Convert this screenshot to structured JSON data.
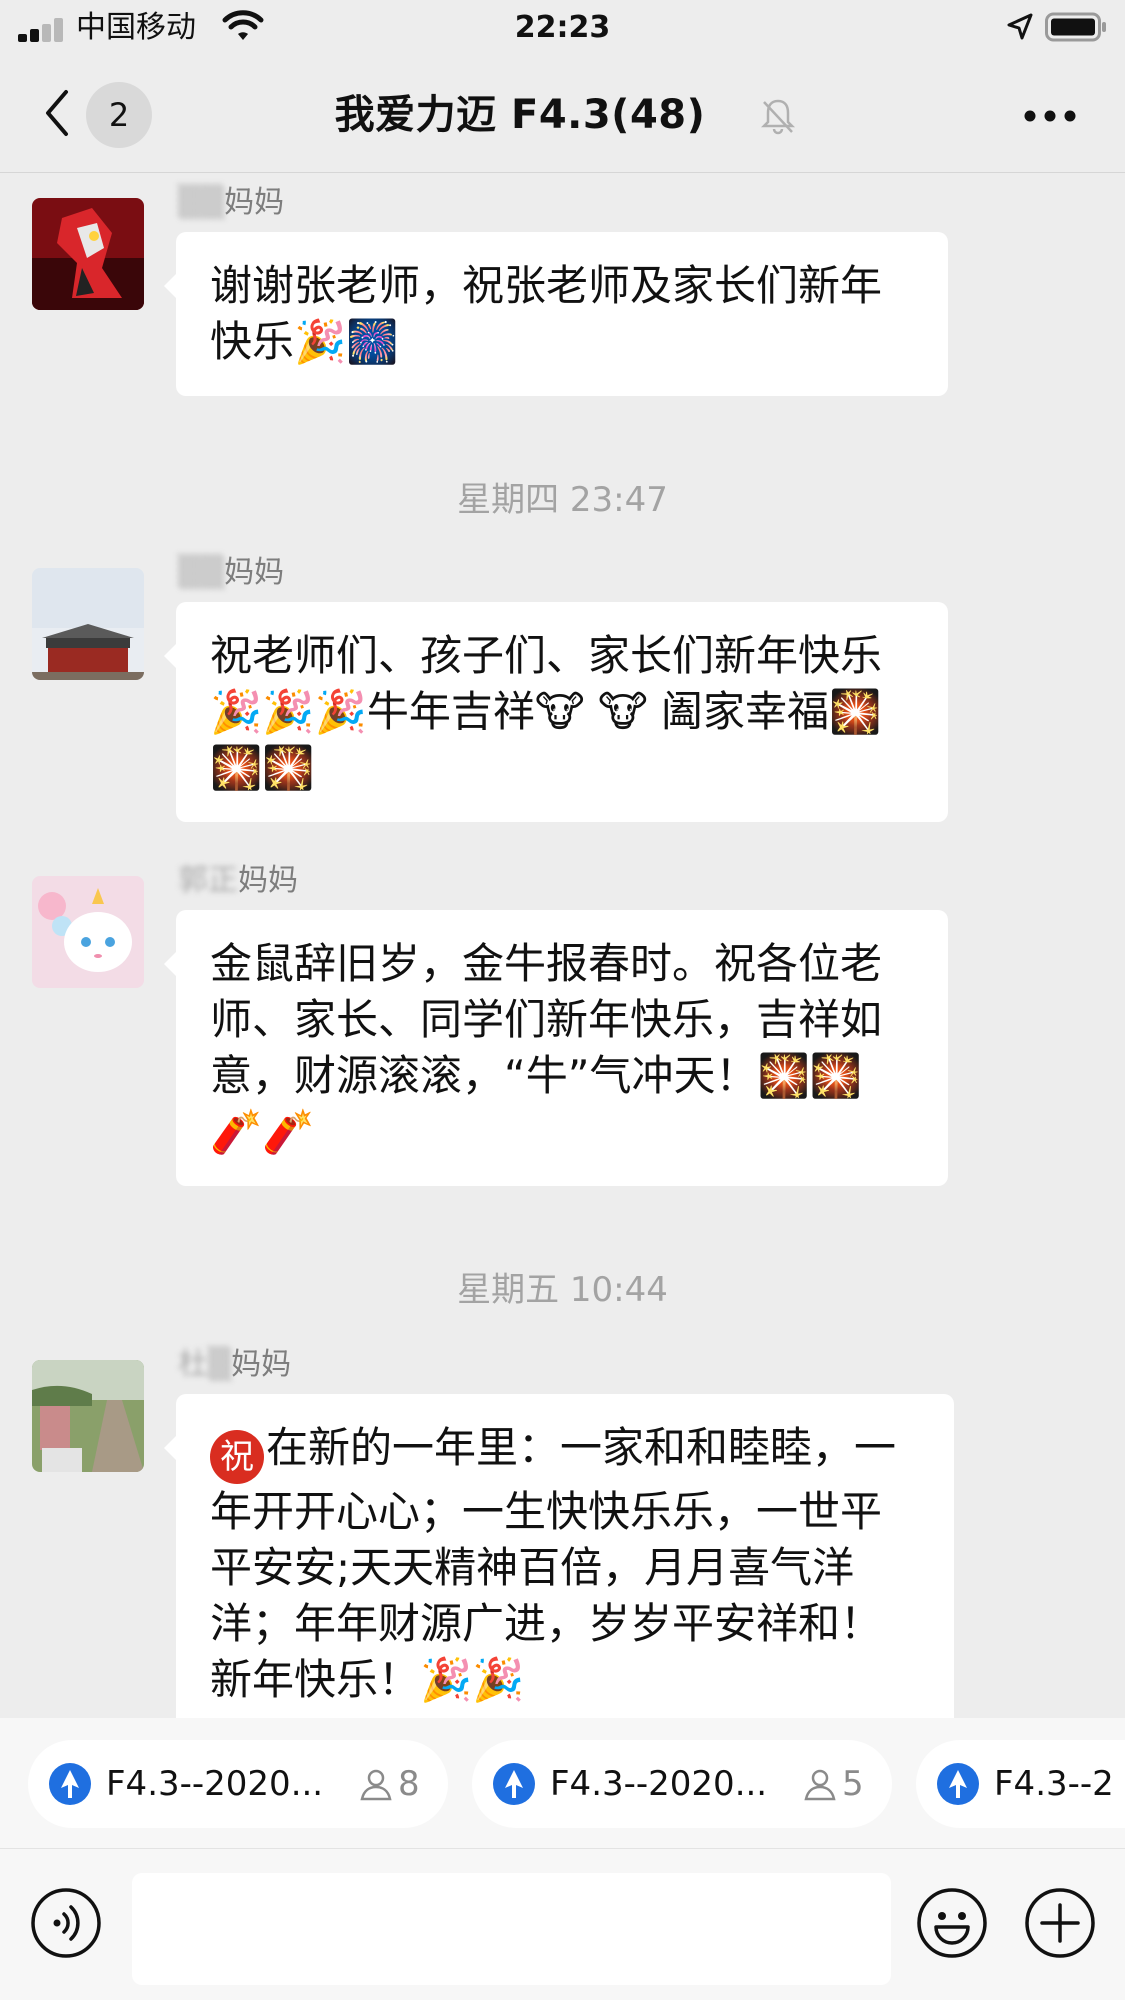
{
  "status_bar": {
    "carrier": "中国移动",
    "time": "22:23"
  },
  "nav": {
    "unread_count": "2",
    "title": "我爱力迈 F4.3(48)",
    "icons": [
      "back-icon",
      "mute-bell-icon",
      "more-icon"
    ]
  },
  "messages": [
    {
      "sender_hidden": "▒▒",
      "sender_visible": "妈妈",
      "text_before": "谢谢张老师，祝张老师及家长们新年快乐",
      "emoji": "🎉🎆",
      "text_after": ""
    },
    {
      "sender_hidden": "▒▒",
      "sender_visible": "妈妈",
      "text_before": "祝老师们、孩子们、家长们新年快乐",
      "emoji": "🎉🎉🎉",
      "text_after": "牛年吉祥🐮 🐮 阖家幸福🎇🎇🎇"
    },
    {
      "sender_hidden": "郭正",
      "sender_visible": "妈妈",
      "text_before": "金鼠辞旧岁，金牛报春时。祝各位老师、家长、同学们新年快乐，吉祥如意，财源滚滚，“牛”气冲天！",
      "emoji": "🎇🎇🧨🧨",
      "text_after": ""
    },
    {
      "sender_hidden": "杜▒",
      "sender_visible": "妈妈",
      "text_before": "在新的一年里：一家和和睦睦，一年开开心心；一生快快乐乐，一世平平安安;天天精神百倍，月月喜气洋洋；年年财源广进，岁岁平安祥和！新年快乐！",
      "emoji": "🎉🎉",
      "text_after": "",
      "prefix_icon": "祝"
    }
  ],
  "timestamps": [
    "星期四 23:47",
    "星期五 10:44"
  ],
  "shortcuts": [
    {
      "label": "F4.3--2020...",
      "count": "8"
    },
    {
      "label": "F4.3--2020...",
      "count": "5"
    },
    {
      "label": "F4.3--2",
      "count": ""
    }
  ],
  "colors": {
    "background": "#ededed",
    "bubble": "#ffffff",
    "accent_blue": "#1f6fe0",
    "timestamp": "#a3a3a3"
  }
}
